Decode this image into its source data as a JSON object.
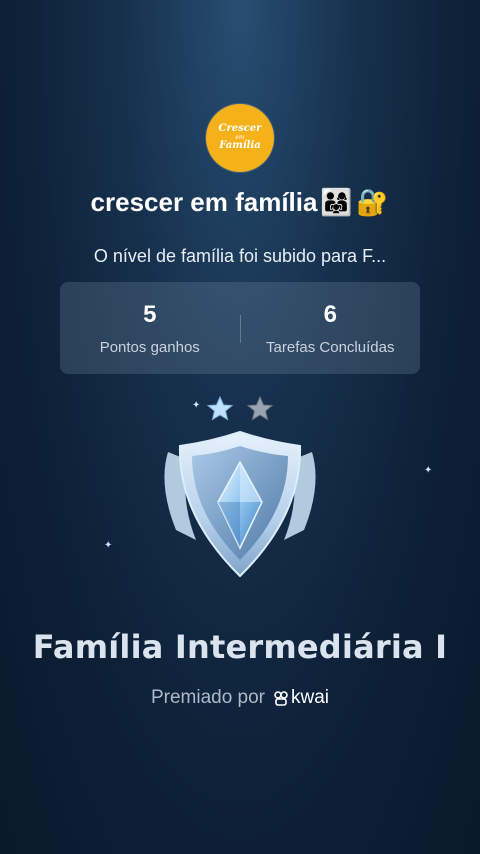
{
  "logo": {
    "line1": "Crescer",
    "line2": "em",
    "line3": "Família"
  },
  "header": {
    "title": "crescer em família",
    "emoji_family": "👨‍👩‍👧",
    "emoji_lock": "🔐",
    "subtitle": "O nível de família foi subido para F..."
  },
  "stats": [
    {
      "value": "5",
      "label": "Pontos ganhos"
    },
    {
      "value": "6",
      "label": "Tarefas Concluídas"
    }
  ],
  "badge": {
    "stars_filled": 1,
    "stars_total": 2,
    "colors": {
      "shield": "#cfe3f6",
      "gem": "#8fc4ef",
      "star_filled": "#bfe0ff",
      "star_empty": "#9aa4b0"
    }
  },
  "level": {
    "name": "Família Intermediária I"
  },
  "awarded": {
    "prefix": "Premiado por",
    "brand": "kwai"
  },
  "icons": [
    "family-emoji-icon",
    "lock-key-emoji-icon",
    "star-icon",
    "shield-badge-icon",
    "kwai-logo-icon",
    "sparkle-icon"
  ]
}
